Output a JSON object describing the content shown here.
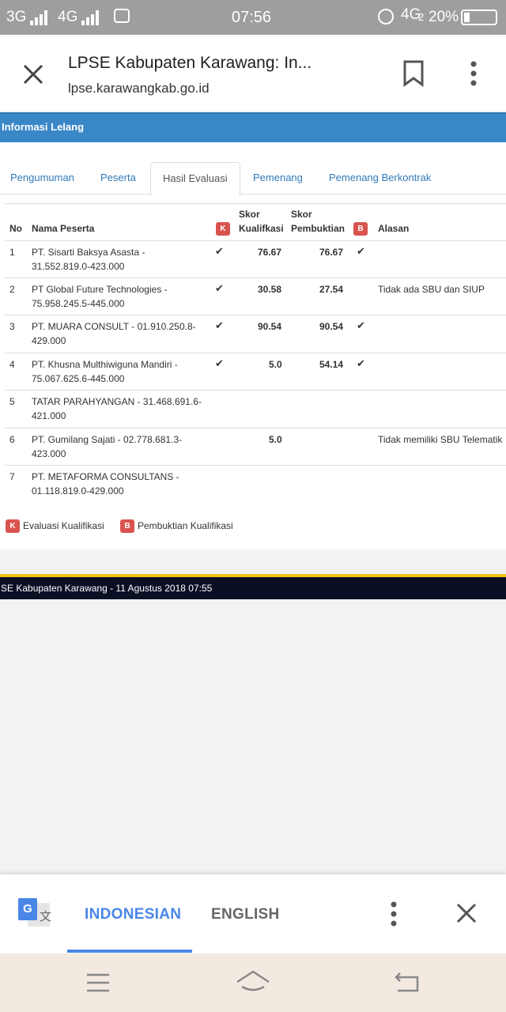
{
  "status_bar": {
    "network1": "3G",
    "network2": "4G",
    "time": "07:56",
    "network3": "4G",
    "network3_sub": "2",
    "battery": "20%"
  },
  "browser": {
    "page_title": "LPSE Kabupaten Karawang: In...",
    "url": "lpse.karawangkab.go.id"
  },
  "section_title": "Informasi Lelang",
  "tabs": [
    {
      "label": "Pengumuman"
    },
    {
      "label": "Peserta"
    },
    {
      "label": "Hasil Evaluasi"
    },
    {
      "label": "Pemenang"
    },
    {
      "label": "Pemenang Berkontrak"
    }
  ],
  "active_tab": "Hasil Evaluasi",
  "table": {
    "headers": {
      "no": "No",
      "nama": "Nama Peserta",
      "k_badge": "K",
      "skor_kual_1": "Skor",
      "skor_kual_2": "Kualifkasi",
      "skor_pemb_1": "Skor",
      "skor_pemb_2": "Pembuktian",
      "b_badge": "B",
      "alasan": "Alasan"
    },
    "rows": [
      {
        "no": "1",
        "name1": "PT. Sisarti Baksya Asasta -",
        "name2": "31.552.819.0-423.000",
        "k": "✔",
        "skor_kual": "76.67",
        "skor_pemb": "76.67",
        "b": "✔",
        "alasan": ""
      },
      {
        "no": "2",
        "name1": "PT Global Future Technologies -",
        "name2": "75.958.245.5-445.000",
        "k": "✔",
        "skor_kual": "30.58",
        "skor_pemb": "27.54",
        "b": "",
        "alasan": "Tidak ada SBU dan SIUP"
      },
      {
        "no": "3",
        "name1": "PT. MUARA CONSULT - 01.910.250.8-",
        "name2": "429.000",
        "k": "✔",
        "skor_kual": "90.54",
        "skor_pemb": "90.54",
        "b": "✔",
        "alasan": ""
      },
      {
        "no": "4",
        "name1": "PT. Khusna Multhiwiguna Mandiri -",
        "name2": "75.067.625.6-445.000",
        "k": "✔",
        "skor_kual": "5.0",
        "skor_pemb": "54.14",
        "b": "✔",
        "alasan": ""
      },
      {
        "no": "5",
        "name1": "TATAR PARAHYANGAN - 31.468.691.6-",
        "name2": "421.000",
        "k": "",
        "skor_kual": "",
        "skor_pemb": "",
        "b": "",
        "alasan": ""
      },
      {
        "no": "6",
        "name1": "PT. Gumilang Sajati - 02.778.681.3-",
        "name2": "423.000",
        "k": "",
        "skor_kual": "5.0",
        "skor_pemb": "",
        "b": "",
        "alasan": "Tidak memiliki SBU Telematik"
      },
      {
        "no": "7",
        "name1": "PT. METAFORMA CONSULTANS -",
        "name2": "01.118.819.0-429.000",
        "k": "",
        "skor_kual": "",
        "skor_pemb": "",
        "b": "",
        "alasan": ""
      }
    ]
  },
  "legend": {
    "k_badge": "K",
    "k_label": "Evaluasi Kualifikasi",
    "b_badge": "B",
    "b_label": "Pembuktian Kualifikasi"
  },
  "footer_text": "SE Kabupaten Karawang - 11 Agustus 2018 07:55",
  "translate": {
    "lang_active": "INDONESIAN",
    "lang_other": "ENGLISH",
    "icon_g": "G",
    "icon_wen": "文"
  },
  "colors": {
    "header_blue": "#3a87c8",
    "badge_red": "#d9534f",
    "link_blue": "#337ab7",
    "translate_active": "#4a86e8",
    "footer_dark": "#0b0f24",
    "footer_accent": "#f0c419"
  }
}
